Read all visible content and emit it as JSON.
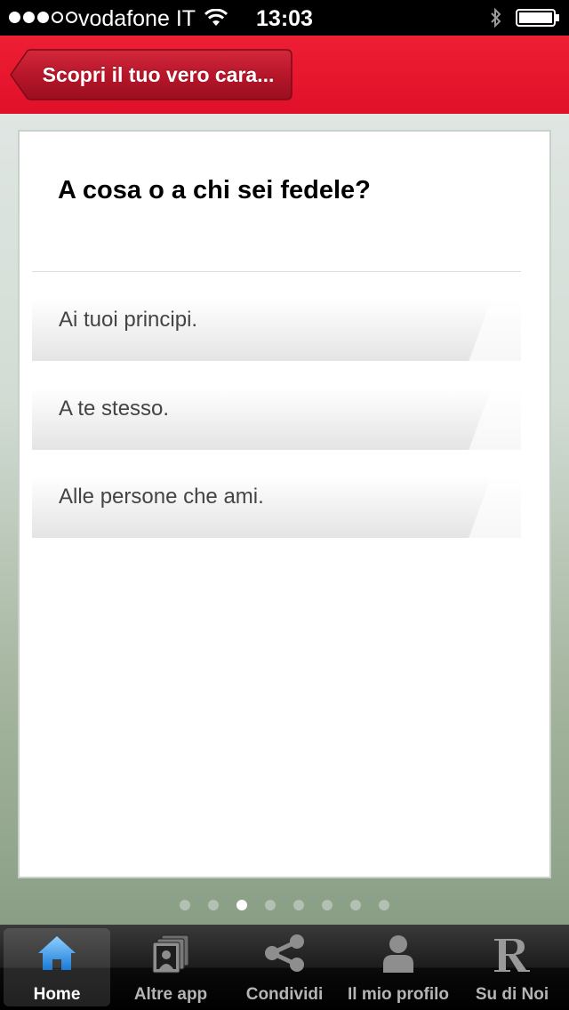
{
  "status_bar": {
    "carrier": "vodafone IT",
    "time": "13:03",
    "signal_bars_filled": 3,
    "signal_bars_total": 5
  },
  "nav_bar": {
    "back_label": "Scopri il tuo vero cara...",
    "color": "#e4142c"
  },
  "question": {
    "text": "A cosa o a chi sei fedele?",
    "answers": [
      {
        "label": "Ai tuoi principi."
      },
      {
        "label": "A te stesso."
      },
      {
        "label": "Alle persone che ami."
      }
    ]
  },
  "pager": {
    "total_pages": 8,
    "current_page": 3
  },
  "tab_bar": {
    "selected": "Home",
    "tabs": [
      {
        "label": "Home",
        "icon": "home-icon"
      },
      {
        "label": "Altre app",
        "icon": "apps-icon"
      },
      {
        "label": "Condividi",
        "icon": "share-icon"
      },
      {
        "label": "Il mio profilo",
        "icon": "profile-icon"
      },
      {
        "label": "Su di Noi",
        "icon": "about-icon"
      }
    ]
  }
}
